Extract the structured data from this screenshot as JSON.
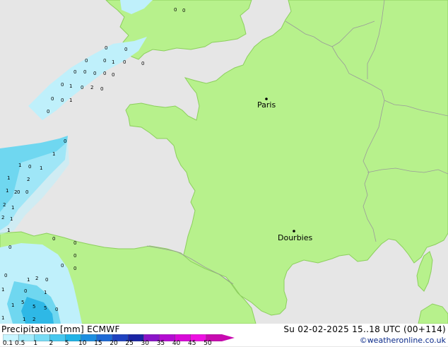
{
  "map": {
    "cities": [
      {
        "name": "Paris"
      },
      {
        "name": "Dourbies"
      }
    ],
    "precip_values_cluster_channel": [
      "0",
      "0",
      "0",
      "0",
      "1",
      "0",
      "0",
      "0",
      "0",
      "0",
      "0",
      "0",
      "0",
      "1",
      "0",
      "2",
      "0",
      "0",
      "0",
      "1",
      "0",
      "0",
      "1"
    ],
    "precip_values_cluster_west": [
      "1",
      "0",
      "1",
      "1",
      "2",
      "0",
      "1",
      "2",
      "2",
      "0",
      "1",
      "2",
      "1",
      "1"
    ],
    "precip_values_cluster_south": [
      "0",
      "0",
      "0",
      "0",
      "2",
      "0",
      "1",
      "1",
      "0",
      "1",
      "5",
      "1",
      "5",
      "5",
      "0",
      "1",
      "1",
      "2",
      "0",
      "0",
      "0"
    ],
    "colors": {
      "sea": "#e6e6e6",
      "land": "#b7f18c",
      "coast": "#8ccf5d",
      "border": "#9a9a9a",
      "precip_light": "#bff0fb",
      "precip_mid": "#6fd7f0",
      "precip_strong": "#2eb8e6"
    }
  },
  "footer": {
    "title_left": "Precipitation [mm]  ECMWF",
    "title_right": "Su 02-02-2025 15..18 UTC (00+114)",
    "credit": "©weatheronline.co.uk",
    "legend_labels": [
      "0.1",
      "0.5",
      "1",
      "2",
      "5",
      "10",
      "15",
      "20",
      "25",
      "30",
      "35",
      "40",
      "45",
      "50"
    ],
    "legend_colors": [
      "#c8f5ff",
      "#a2ebfb",
      "#78dcf5",
      "#46c8ef",
      "#1fb3e6",
      "#1c8ee0",
      "#1e6ad6",
      "#1f42c0",
      "#1a24a4",
      "#8a14c8",
      "#b40cd2",
      "#d80ad8",
      "#ee10e2",
      "#c80ab0"
    ]
  }
}
